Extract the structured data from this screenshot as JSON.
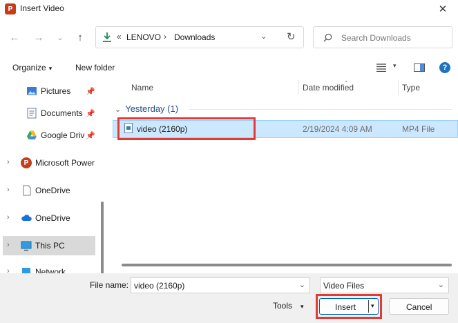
{
  "window": {
    "title": "Insert Video",
    "app_icon_letter": "P",
    "close_glyph": "✕"
  },
  "nav": {
    "back_glyph": "←",
    "forward_glyph": "→",
    "recent_glyph": "⌄",
    "up_glyph": "↑",
    "address": {
      "overflow": "«",
      "segments": [
        "LENOVO",
        "Downloads"
      ],
      "separator": "›",
      "dropdown_glyph": "⌄",
      "refresh_glyph": "↻"
    },
    "search": {
      "placeholder": "Search Downloads"
    }
  },
  "commands": {
    "organize_label": "Organize",
    "new_folder_label": "New folder",
    "caret": "▾",
    "help_glyph": "?"
  },
  "sidebar": {
    "items": [
      {
        "label": "Pictures",
        "icon": "pictures-icon",
        "pinned": true,
        "expandable": false
      },
      {
        "label": "Documents",
        "icon": "documents-icon",
        "pinned": true,
        "expandable": false
      },
      {
        "label": "Google Drive",
        "icon": "google-drive-icon",
        "pinned": true,
        "expandable": false
      },
      {
        "label": "Microsoft Power",
        "icon": "powerpoint-icon",
        "pinned": false,
        "expandable": true
      },
      {
        "label": "OneDrive",
        "icon": "document-outline-icon",
        "pinned": false,
        "expandable": true
      },
      {
        "label": "OneDrive",
        "icon": "cloud-icon",
        "pinned": false,
        "expandable": true
      },
      {
        "label": "This PC",
        "icon": "computer-icon",
        "pinned": false,
        "expandable": true,
        "selected": true
      },
      {
        "label": "Network",
        "icon": "network-icon",
        "pinned": false,
        "expandable": true
      }
    ],
    "pin_glyph": "📌",
    "chevron_glyph": "›"
  },
  "filelist": {
    "columns": [
      "Name",
      "Date modified",
      "Type"
    ],
    "sort_glyph": "⌄",
    "group": {
      "label": "Yesterday (1)",
      "chevron": "⌄"
    },
    "rows": [
      {
        "name": "video (2160p)",
        "date": "2/19/2024 4:09 AM",
        "type": "MP4 File",
        "selected": true
      }
    ]
  },
  "bottom": {
    "file_name_label": "File name:",
    "file_name_value": "video (2160p)",
    "file_type_value": "Video Files",
    "dropdown_glyph": "⌄",
    "tools_label": "Tools",
    "insert_label": "Insert",
    "cancel_label": "Cancel"
  },
  "colors": {
    "highlight": "#e53935",
    "selection": "#cce8ff",
    "accent": "#0067c0",
    "group_text": "#1e4e8c"
  }
}
